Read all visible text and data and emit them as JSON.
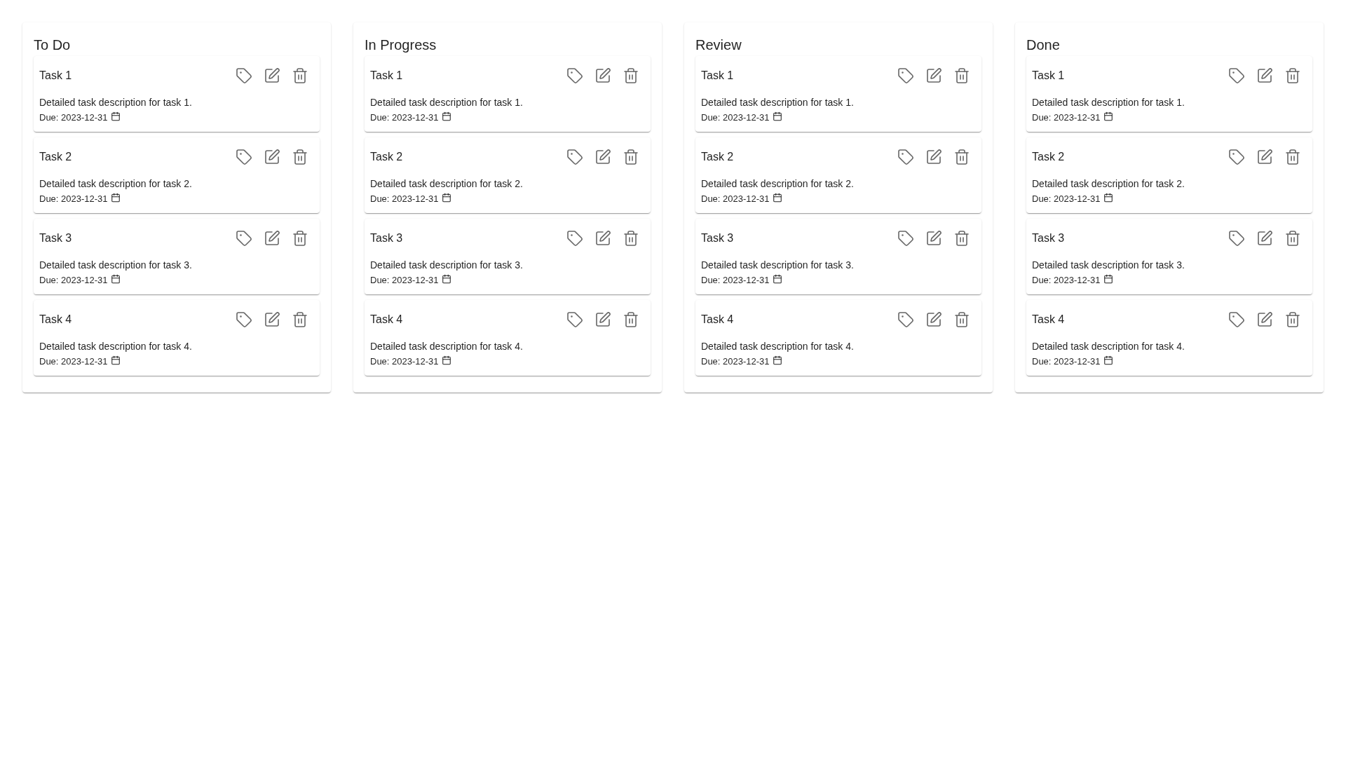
{
  "columns": [
    {
      "title": "To Do",
      "tasks": [
        {
          "title": "Task 1",
          "description": "Detailed task description for task 1.",
          "due": "Due: 2023-12-31"
        },
        {
          "title": "Task 2",
          "description": "Detailed task description for task 2.",
          "due": "Due: 2023-12-31"
        },
        {
          "title": "Task 3",
          "description": "Detailed task description for task 3.",
          "due": "Due: 2023-12-31"
        },
        {
          "title": "Task 4",
          "description": "Detailed task description for task 4.",
          "due": "Due: 2023-12-31"
        }
      ]
    },
    {
      "title": "In Progress",
      "tasks": [
        {
          "title": "Task 1",
          "description": "Detailed task description for task 1.",
          "due": "Due: 2023-12-31"
        },
        {
          "title": "Task 2",
          "description": "Detailed task description for task 2.",
          "due": "Due: 2023-12-31"
        },
        {
          "title": "Task 3",
          "description": "Detailed task description for task 3.",
          "due": "Due: 2023-12-31"
        },
        {
          "title": "Task 4",
          "description": "Detailed task description for task 4.",
          "due": "Due: 2023-12-31"
        }
      ]
    },
    {
      "title": "Review",
      "tasks": [
        {
          "title": "Task 1",
          "description": "Detailed task description for task 1.",
          "due": "Due: 2023-12-31"
        },
        {
          "title": "Task 2",
          "description": "Detailed task description for task 2.",
          "due": "Due: 2023-12-31"
        },
        {
          "title": "Task 3",
          "description": "Detailed task description for task 3.",
          "due": "Due: 2023-12-31"
        },
        {
          "title": "Task 4",
          "description": "Detailed task description for task 4.",
          "due": "Due: 2023-12-31"
        }
      ]
    },
    {
      "title": "Done",
      "tasks": [
        {
          "title": "Task 1",
          "description": "Detailed task description for task 1.",
          "due": "Due: 2023-12-31"
        },
        {
          "title": "Task 2",
          "description": "Detailed task description for task 2.",
          "due": "Due: 2023-12-31"
        },
        {
          "title": "Task 3",
          "description": "Detailed task description for task 3.",
          "due": "Due: 2023-12-31"
        },
        {
          "title": "Task 4",
          "description": "Detailed task description for task 4.",
          "due": "Due: 2023-12-31"
        }
      ]
    }
  ]
}
